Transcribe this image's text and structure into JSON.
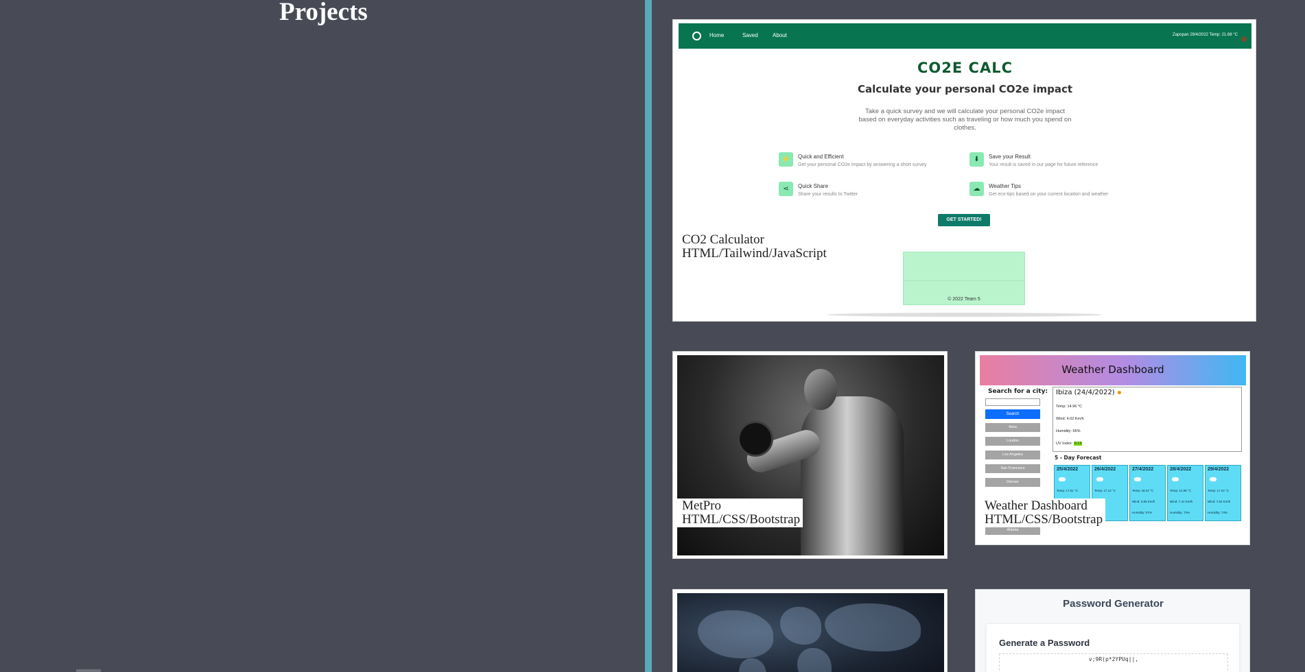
{
  "section": {
    "title": "Projects"
  },
  "projects": {
    "co2": {
      "label_name": "CO2 Calculator",
      "label_tech": "HTML/Tailwind/JavaScript",
      "preview": {
        "nav": [
          "Home",
          "Saved",
          "About"
        ],
        "status": "Zapopan 29/4/2022 Temp: 21.68 °C",
        "brand": "CO2E CALC",
        "heading": "Calculate your personal CO2e impact",
        "description": "Take a quick survey and we will calculate your personal CO2e impact based on everyday activities such as traveling or how much you spend on clothes.",
        "features": [
          {
            "title": "Quick and Efficient",
            "text": "Get your personal CO2e impact by answering a short survey",
            "icon": "lightning-icon"
          },
          {
            "title": "Save your Result",
            "text": "Your result is saved in our page for future reference",
            "icon": "save-icon"
          },
          {
            "title": "Quick Share",
            "text": "Share your results to Twitter",
            "icon": "share-icon"
          },
          {
            "title": "Weather Tips",
            "text": "Get eco-tips based on your current location and weather",
            "icon": "cloud-icon"
          }
        ],
        "cta": "GET STARTED!",
        "footer": "© 2022 Team 5"
      }
    },
    "metpro": {
      "label_name": "MetPro",
      "label_tech": "HTML/CSS/Bootstrap"
    },
    "weather": {
      "label_name": "Weather Dashboard",
      "label_tech": "HTML/CSS/Bootstrap",
      "preview": {
        "title": "Weather Dashboard",
        "search_label": "Search for a city:",
        "search_button": "Search",
        "cities": [
          "Ibiza",
          "London",
          "Los Angeles",
          "San Francisco",
          "Denver",
          "Atlanta"
        ],
        "current": {
          "title": "Ibiza (24/4/2022)",
          "temp": "Temp: 14.96 °C",
          "wind": "Wind: 4.02 Km/h",
          "humidity": "Humidity: 65%",
          "uv_label": "UV Index:",
          "uv_value": "0.13"
        },
        "forecast_title": "5 - Day Forecast",
        "forecast": [
          {
            "date": "25/4/2022",
            "temp": "Temp: 17.51 °C",
            "wind": "",
            "humidity": ""
          },
          {
            "date": "26/4/2022",
            "temp": "Temp: 17.12 °C",
            "wind": "",
            "humidity": ""
          },
          {
            "date": "27/4/2022",
            "temp": "Temp: 18.24 °C",
            "wind": "Wind: 3.85 Km/h",
            "humidity": "Humidity: 57%"
          },
          {
            "date": "28/4/2022",
            "temp": "Temp: 14.88 °C",
            "wind": "Wind: 7.41 Km/h",
            "humidity": "Humidity: 74%"
          },
          {
            "date": "29/4/2022",
            "temp": "Temp: 17.24 °C",
            "wind": "Wind: 7.62 Km/h",
            "humidity": "Humidity: 74%"
          }
        ]
      }
    },
    "password": {
      "preview": {
        "title": "Password Generator",
        "heading": "Generate a Password",
        "output": "v;9R(p*2YPUq||,"
      }
    }
  },
  "colors": {
    "background": "#484b56",
    "divider": "#5aa9b8",
    "co2_nav": "#087550",
    "weather_card": "#5fdcf5"
  }
}
